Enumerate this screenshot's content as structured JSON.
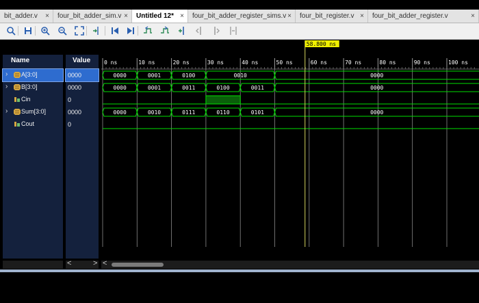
{
  "tabs": [
    {
      "label": "bit_adder.v",
      "close": "×",
      "active": false
    },
    {
      "label": "four_bit_adder_sim.v",
      "close": "×",
      "active": false
    },
    {
      "label": "Untitled 12*",
      "close": "×",
      "active": true
    },
    {
      "label": "four_bit_adder_register_sims.v",
      "close": "×",
      "active": false
    },
    {
      "label": "four_bit_register.v",
      "close": "×",
      "active": false
    },
    {
      "label": "four_bit_adder_register.v",
      "close": "×",
      "active": false
    }
  ],
  "toolbar": [
    "search-icon",
    "save-icon",
    "zoom-in-icon",
    "zoom-out-icon",
    "zoom-fit-icon",
    "go-to-cursor-icon",
    "go-to-start-icon",
    "go-to-end-icon",
    "previous-transition-icon",
    "next-transition-icon",
    "add-marker-icon",
    "previous-marker-icon",
    "next-marker-icon",
    "swap-cursors-icon"
  ],
  "columns": {
    "name": "Name",
    "value": "Value"
  },
  "signals": [
    {
      "name": "A[3:0]",
      "value": "0000",
      "type": "bus",
      "expandable": true,
      "selected": true
    },
    {
      "name": "B[3:0]",
      "value": "0000",
      "type": "bus",
      "expandable": true,
      "selected": false
    },
    {
      "name": "Cin",
      "value": "0",
      "type": "bit",
      "expandable": false,
      "selected": false
    },
    {
      "name": "Sum[3:0]",
      "value": "0000",
      "type": "bus",
      "expandable": true,
      "selected": false
    },
    {
      "name": "Cout",
      "value": "0",
      "type": "bit",
      "expandable": false,
      "selected": false
    }
  ],
  "timeline": {
    "unit": "ns",
    "ticks": [
      0,
      10,
      20,
      30,
      40,
      50,
      60,
      70,
      80,
      90,
      100
    ],
    "cursor": "58.800 ns",
    "cursor_time": 58.8
  },
  "waveforms": {
    "A[3:0]": [
      {
        "start": 0,
        "end": 10,
        "value": "0000"
      },
      {
        "start": 10,
        "end": 20,
        "value": "0001"
      },
      {
        "start": 20,
        "end": 30,
        "value": "0100"
      },
      {
        "start": 30,
        "end": 50,
        "value": "0010"
      },
      {
        "start": 50,
        "end": 110,
        "value": "0000"
      }
    ],
    "B[3:0]": [
      {
        "start": 0,
        "end": 10,
        "value": "0000"
      },
      {
        "start": 10,
        "end": 20,
        "value": "0001"
      },
      {
        "start": 20,
        "end": 30,
        "value": "0011"
      },
      {
        "start": 30,
        "end": 40,
        "value": "0100"
      },
      {
        "start": 40,
        "end": 50,
        "value": "0011"
      },
      {
        "start": 50,
        "end": 110,
        "value": "0000"
      }
    ],
    "Cin": [
      {
        "start": 0,
        "end": 30,
        "value": 0
      },
      {
        "start": 30,
        "end": 40,
        "value": 1
      },
      {
        "start": 40,
        "end": 110,
        "value": 0
      }
    ],
    "Sum[3:0]": [
      {
        "start": 0,
        "end": 10,
        "value": "0000"
      },
      {
        "start": 10,
        "end": 20,
        "value": "0010"
      },
      {
        "start": 20,
        "end": 30,
        "value": "0111"
      },
      {
        "start": 30,
        "end": 40,
        "value": "0110"
      },
      {
        "start": 40,
        "end": 50,
        "value": "0101"
      },
      {
        "start": 50,
        "end": 110,
        "value": "0000"
      }
    ],
    "Cout": [
      {
        "start": 0,
        "end": 110,
        "value": 0
      }
    ]
  },
  "scrollbars": {
    "left": "<",
    "right": ">"
  },
  "colors": {
    "waveform": "#00e000",
    "cursor": "#d8d860",
    "cursor_label_bg": "#f0f000",
    "panel_bg": "#14213d",
    "selection": "#2e6ccf"
  }
}
